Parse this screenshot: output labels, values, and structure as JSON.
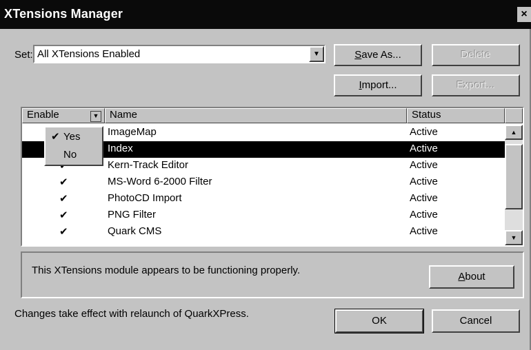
{
  "window": {
    "title": "XTensions Manager",
    "close_label": "×"
  },
  "set": {
    "label": "Set:",
    "label_mnemonic": "t",
    "value": "All XTensions Enabled"
  },
  "buttons": {
    "save_as": {
      "mn": "S",
      "rest": "ave As..."
    },
    "delete": "Delete",
    "import": {
      "mn": "I",
      "rest": "mport..."
    },
    "export": "Export...",
    "about": {
      "mn": "A",
      "rest": "bout"
    },
    "ok": "OK",
    "cancel": "Cancel"
  },
  "table": {
    "columns": {
      "enable": "Enable",
      "name": "Name",
      "status": "Status"
    },
    "rows": [
      {
        "enabled": "✔",
        "name": "ImageMap",
        "status": "Active",
        "selected": false
      },
      {
        "enabled": "✔",
        "name": "Index",
        "status": "Active",
        "selected": true
      },
      {
        "enabled": "✔",
        "name": "Kern-Track Editor",
        "status": "Active",
        "selected": false
      },
      {
        "enabled": "✔",
        "name": "MS-Word 6-2000 Filter",
        "status": "Active",
        "selected": false
      },
      {
        "enabled": "✔",
        "name": "PhotoCD Import",
        "status": "Active",
        "selected": false
      },
      {
        "enabled": "✔",
        "name": "PNG Filter",
        "status": "Active",
        "selected": false
      },
      {
        "enabled": "✔",
        "name": "Quark CMS",
        "status": "Active",
        "selected": false
      }
    ]
  },
  "enable_menu": {
    "options": [
      "Yes",
      "No"
    ],
    "checked": "Yes",
    "check_mark": "✔"
  },
  "info": {
    "text": "This XTensions module appears to be functioning properly."
  },
  "footer": {
    "note": "Changes take effect with relaunch of QuarkXPress."
  },
  "icons": {
    "dropdown": "chevron-down-icon",
    "scroll_up": "arrow-up-icon",
    "scroll_down": "arrow-down-icon",
    "check": "check-icon"
  }
}
